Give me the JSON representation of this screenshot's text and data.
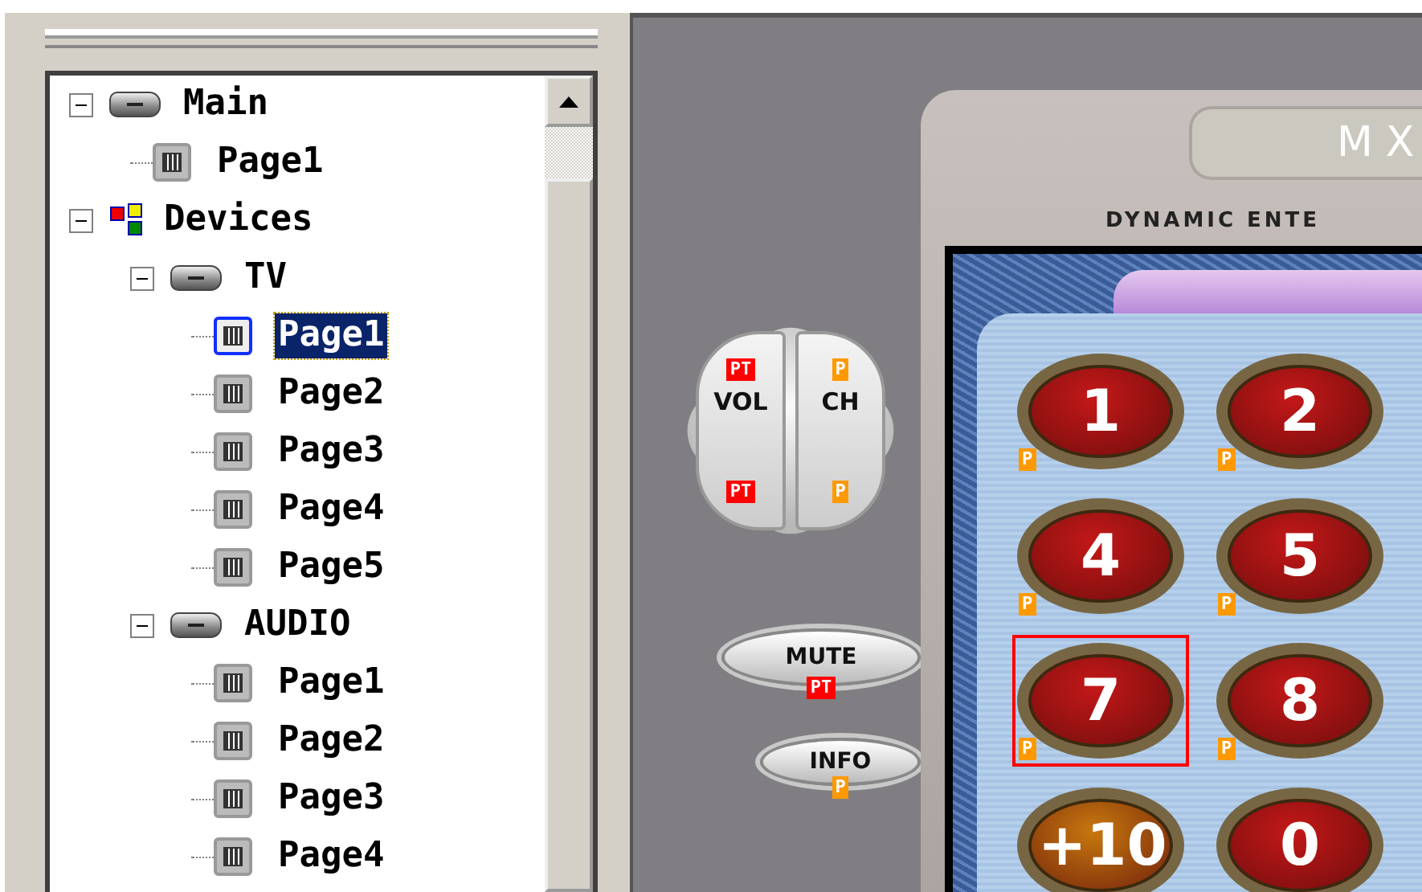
{
  "tree": [
    {
      "label": "Main",
      "kind": "device",
      "expanded": true,
      "selected": false,
      "children": [
        {
          "label": "Page1",
          "kind": "page",
          "selected": false
        }
      ]
    },
    {
      "label": "Devices",
      "kind": "group",
      "expanded": true,
      "selected": false,
      "children": [
        {
          "label": "TV",
          "kind": "device",
          "expanded": true,
          "selected": false,
          "children": [
            {
              "label": "Page1",
              "kind": "page",
              "selected": true
            },
            {
              "label": "Page2",
              "kind": "page",
              "selected": false
            },
            {
              "label": "Page3",
              "kind": "page",
              "selected": false
            },
            {
              "label": "Page4",
              "kind": "page",
              "selected": false
            },
            {
              "label": "Page5",
              "kind": "page",
              "selected": false
            }
          ]
        },
        {
          "label": "AUDIO",
          "kind": "device",
          "expanded": true,
          "selected": false,
          "children": [
            {
              "label": "Page1",
              "kind": "page",
              "selected": false
            },
            {
              "label": "Page2",
              "kind": "page",
              "selected": false
            },
            {
              "label": "Page3",
              "kind": "page",
              "selected": false
            },
            {
              "label": "Page4",
              "kind": "page",
              "selected": false
            }
          ]
        }
      ]
    }
  ],
  "rocker": [
    {
      "label": "VOL",
      "top_badge": {
        "text": "PT",
        "color": "#ff0000"
      },
      "bottom_badge": {
        "text": "PT",
        "color": "#ff0000"
      }
    },
    {
      "label": "CH",
      "top_badge": {
        "text": "P",
        "color": "#ff9900"
      },
      "bottom_badge": {
        "text": "P",
        "color": "#ff9900"
      }
    }
  ],
  "side_buttons": [
    {
      "label": "MUTE",
      "badge": {
        "text": "PT",
        "color": "#ff0000"
      }
    },
    {
      "label": "INFO",
      "badge": {
        "text": "P",
        "color": "#ff9900"
      }
    }
  ],
  "remote": {
    "model": "MX",
    "brand": "DYNAMIC ENTE",
    "keys": [
      {
        "label": "1",
        "color": "#c41818",
        "selected": false,
        "badge": {
          "text": "P",
          "color": "#ff9900"
        }
      },
      {
        "label": "2",
        "color": "#c41818",
        "selected": false,
        "badge": {
          "text": "P",
          "color": "#ff9900"
        }
      },
      {
        "label": "4",
        "color": "#c41818",
        "selected": false,
        "badge": {
          "text": "P",
          "color": "#ff9900"
        }
      },
      {
        "label": "5",
        "color": "#c41818",
        "selected": false,
        "badge": {
          "text": "P",
          "color": "#ff9900"
        }
      },
      {
        "label": "7",
        "color": "#c41818",
        "selected": true,
        "badge": {
          "text": "P",
          "color": "#ff9900"
        }
      },
      {
        "label": "8",
        "color": "#c41818",
        "selected": false,
        "badge": {
          "text": "P",
          "color": "#ff9900"
        }
      },
      {
        "label": "+10",
        "color": "#c8780e",
        "selected": false
      },
      {
        "label": "0",
        "color": "#c41818",
        "selected": false
      }
    ]
  }
}
